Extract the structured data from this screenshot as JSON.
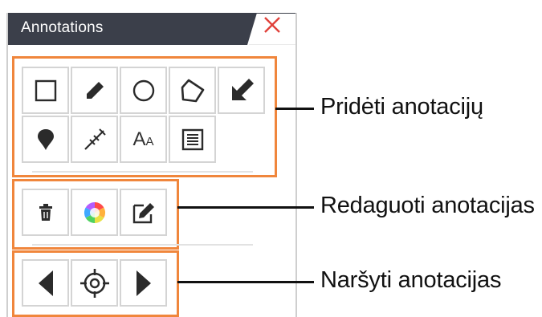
{
  "panel": {
    "title": "Annotations",
    "header_color": "#3b3f4a",
    "accent_color": "#f0863c",
    "close_icon_color": "#e0413a"
  },
  "add_group": {
    "tools": [
      {
        "icon": "rectangle-icon"
      },
      {
        "icon": "pencil-icon"
      },
      {
        "icon": "circle-icon"
      },
      {
        "icon": "polygon-icon"
      },
      {
        "icon": "arrow-icon"
      },
      {
        "icon": "pin-icon"
      },
      {
        "icon": "ruler-measure-icon"
      },
      {
        "icon": "text-icon",
        "label_big": "A",
        "label_small": "A"
      },
      {
        "icon": "note-icon"
      }
    ],
    "callout": "Pridėti anotacijų"
  },
  "edit_group": {
    "tools": [
      {
        "icon": "trash-icon"
      },
      {
        "icon": "color-wheel-icon"
      },
      {
        "icon": "edit-icon"
      }
    ],
    "callout": "Redaguoti anotacijas"
  },
  "nav_group": {
    "tools": [
      {
        "icon": "previous-icon"
      },
      {
        "icon": "locate-icon"
      },
      {
        "icon": "next-icon"
      }
    ],
    "callout": "Naršyti anotacijas"
  }
}
